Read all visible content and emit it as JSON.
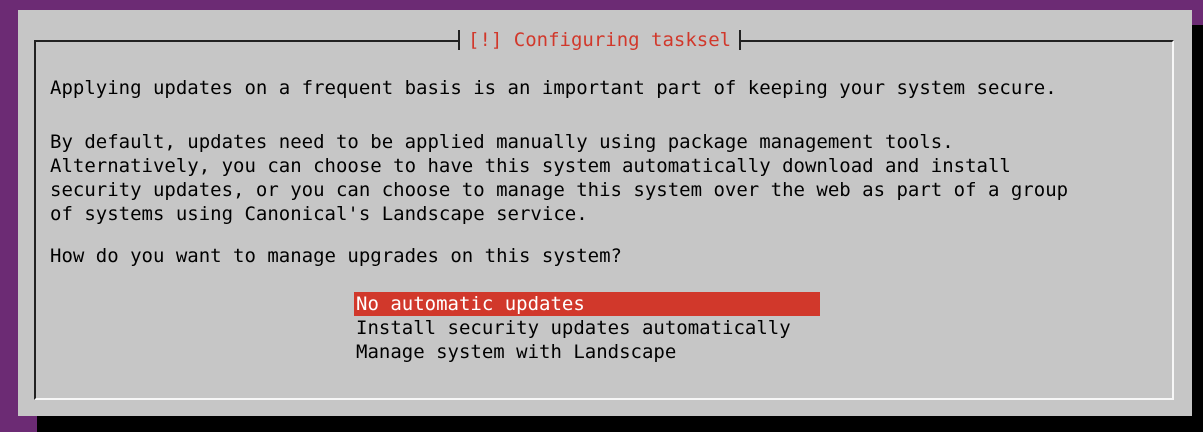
{
  "dialog": {
    "title": "[!] Configuring tasksel",
    "line1": "Applying updates on a frequent basis is an important part of keeping your system secure.",
    "para2": "By default, updates need to be applied manually using package management tools.\nAlternatively, you can choose to have this system automatically download and install\nsecurity updates, or you can choose to manage this system over the web as part of a group\nof systems using Canonical's Landscape service.",
    "question": "How do you want to manage upgrades on this system?"
  },
  "options": [
    {
      "label": "No automatic updates",
      "selected": true
    },
    {
      "label": "Install security updates automatically",
      "selected": false
    },
    {
      "label": "Manage system with Landscape",
      "selected": false
    }
  ],
  "colors": {
    "background": "#6c2b74",
    "dialog": "#c6c6c6",
    "accent": "#d1382b"
  }
}
